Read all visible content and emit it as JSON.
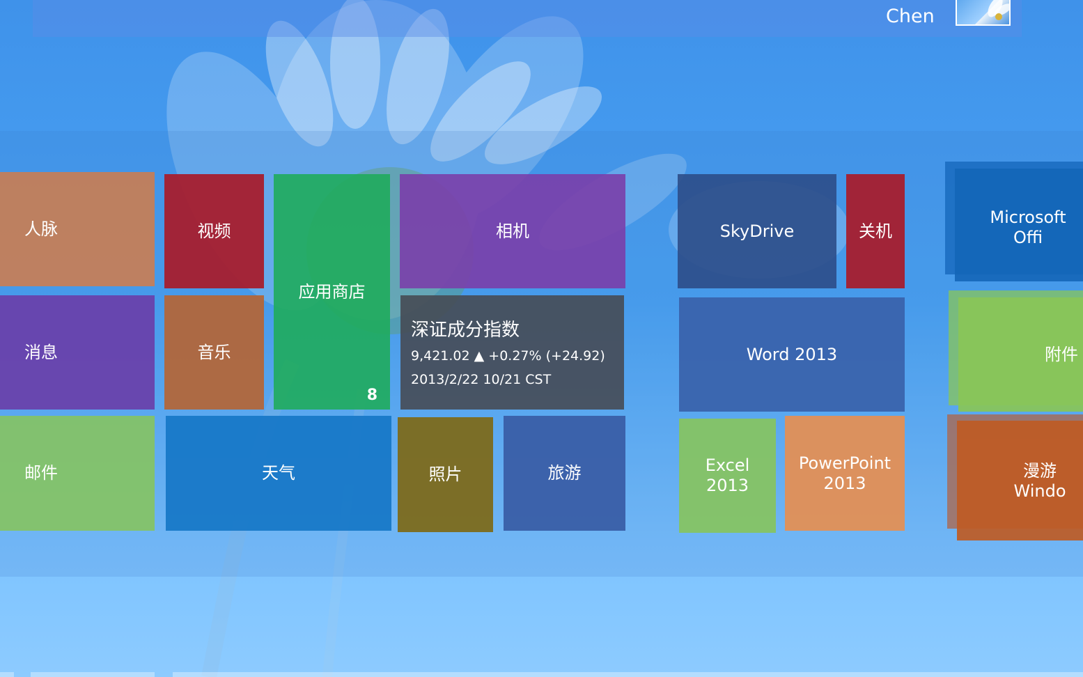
{
  "user": {
    "name": "Chen",
    "avatar_icon": "daisy-avatar"
  },
  "tiles": {
    "people": {
      "label": "人脉",
      "color": "#c97e55"
    },
    "messaging": {
      "label": "消息",
      "color": "#6a3fa9"
    },
    "mail": {
      "label": "邮件",
      "color": "#86c364"
    },
    "video": {
      "label": "视频",
      "color": "#a71d2e"
    },
    "music": {
      "label": "音乐",
      "color": "#b2663b"
    },
    "store": {
      "label": "应用商店",
      "badge": "8",
      "color": "#1fab5c"
    },
    "camera": {
      "label": "相机",
      "color": "#7a3eaa"
    },
    "weather": {
      "label": "天气",
      "color": "#1878c8"
    },
    "photos": {
      "label": "照片",
      "color": "#7d6a1c"
    },
    "travel": {
      "label": "旅游",
      "color": "#3a5ea8"
    },
    "skydrive": {
      "label": "SkyDrive",
      "color": "#2c4c88"
    },
    "shutdown": {
      "label": "关机",
      "color": "#a71d2e"
    },
    "word": {
      "label": "Word 2013",
      "color": "#3a62aa"
    },
    "excel": {
      "label": "Excel\n2013",
      "color": "#86c364"
    },
    "powerpoint": {
      "label": "PowerPoint\n2013",
      "color": "#e38f56"
    },
    "office": {
      "label": "Microsoft Offi",
      "color": "#1466b8"
    },
    "accessories": {
      "label": "附件",
      "color": "#8ac657"
    },
    "windows_tour": {
      "label": "漫游 Windo",
      "color": "#bf5b24"
    }
  },
  "stock": {
    "name": "深证成分指数",
    "quote": "9,421.02 ▲ +0.27% (+24.92)",
    "timestamp": "2013/2/22 10/21 CST",
    "color": "#464a54"
  }
}
